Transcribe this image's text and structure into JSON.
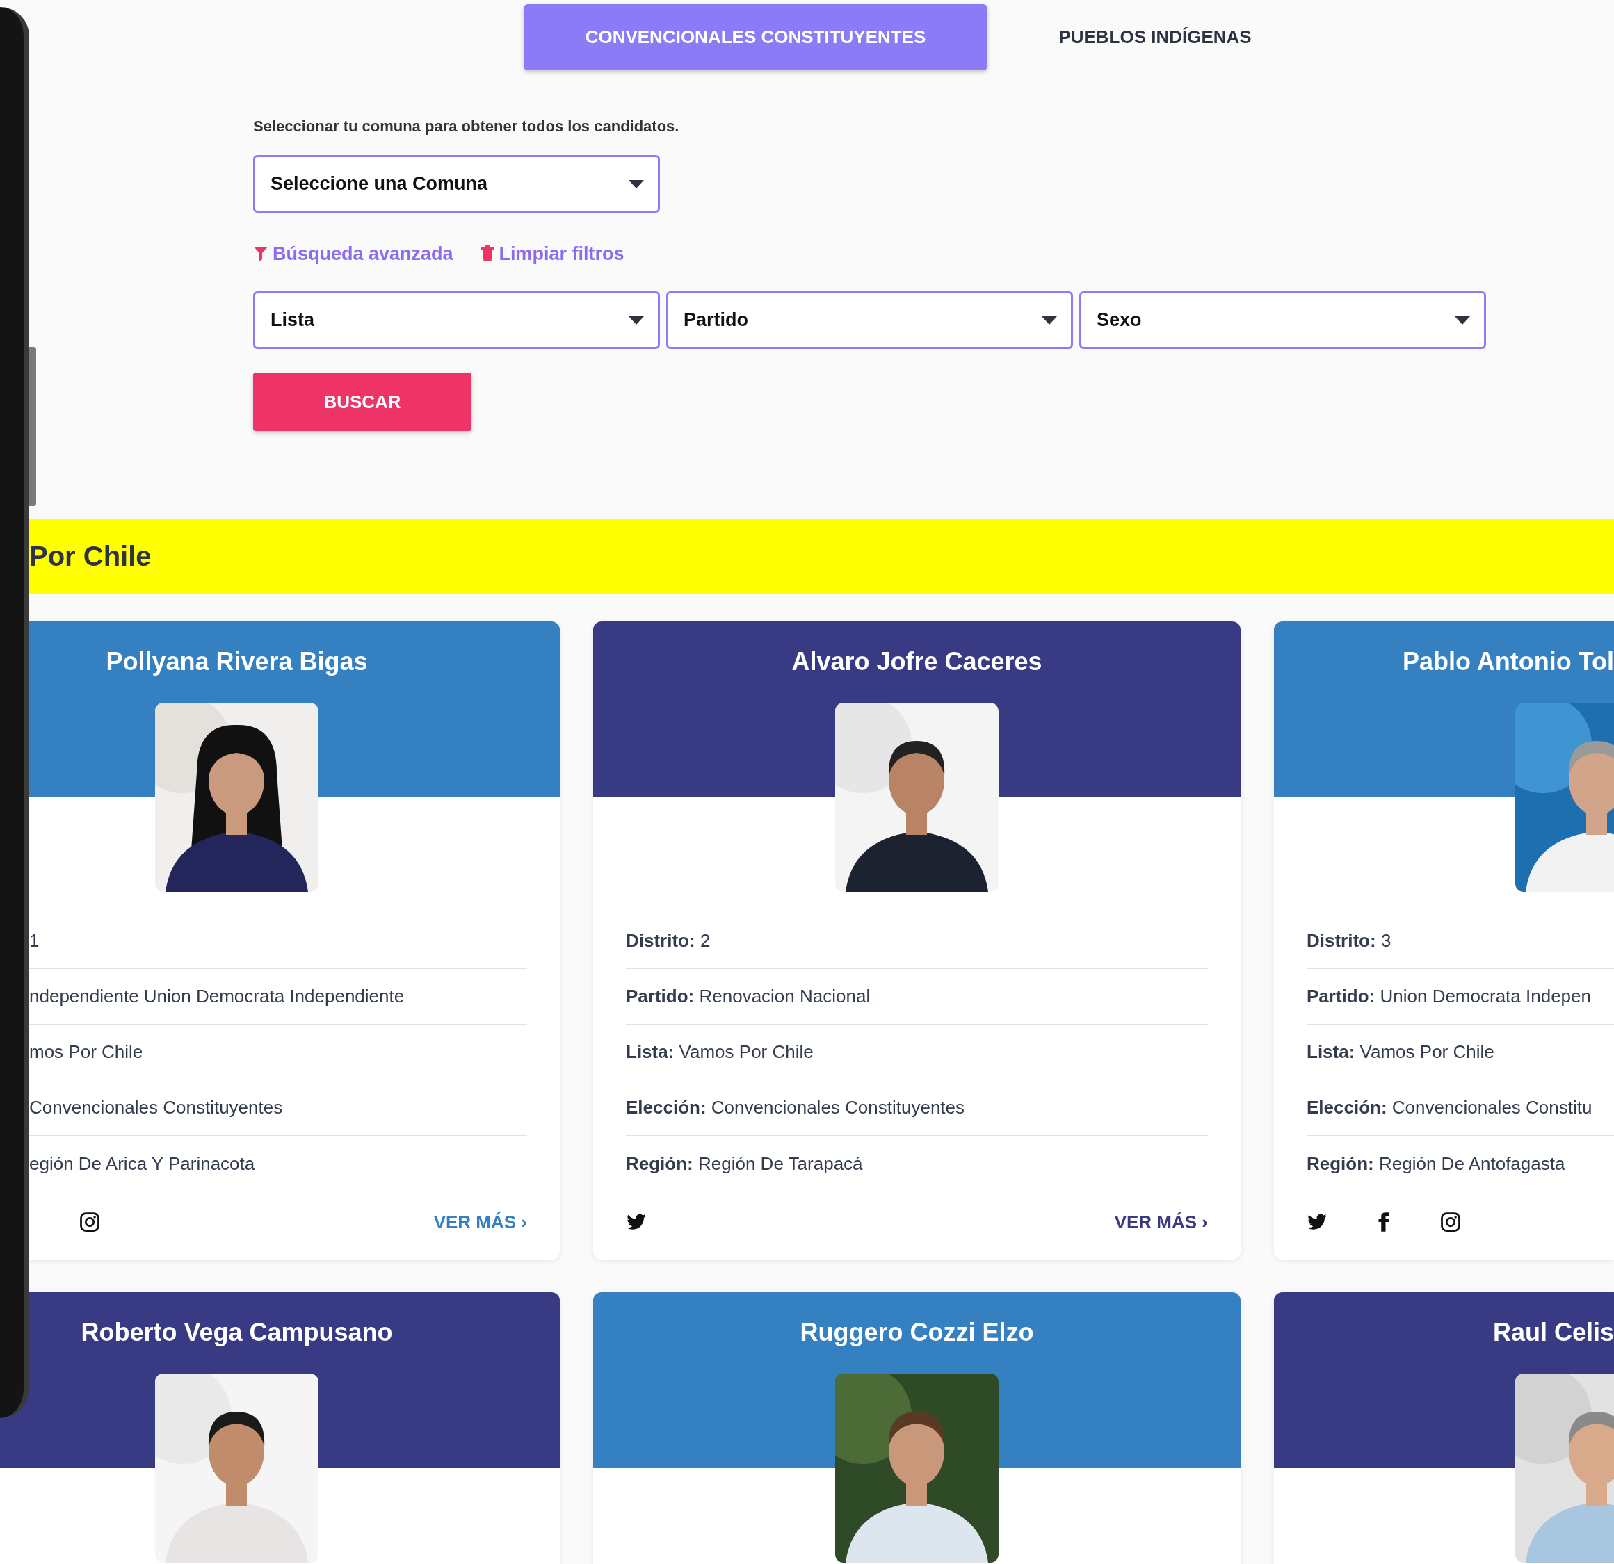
{
  "tabs": [
    {
      "label": "CONVENCIONALES CONSTITUYENTES",
      "selected": true
    },
    {
      "label": "PUEBLOS INDÍGENAS",
      "selected": false
    }
  ],
  "instruction": "Seleccionar tu comuna para obtener todos los candidatos.",
  "comuna_select": {
    "value": "Seleccione una Comuna"
  },
  "links": [
    {
      "kind": "filter",
      "label": "Búsqueda avanzada"
    },
    {
      "kind": "clear",
      "label": "Limpiar filtros"
    }
  ],
  "filters": [
    {
      "value": "Lista"
    },
    {
      "value": "Partido"
    },
    {
      "value": "Sexo"
    }
  ],
  "search_button": "BUSCAR",
  "group": {
    "title": "Por Chile"
  },
  "card_rows": [
    {
      "cards": [
        {
          "name": "Pollyana Rivera Bigas",
          "color": "#3480c0",
          "photo": {
            "kind": "picture"
          },
          "details": [
            {
              "value": "1"
            },
            {
              "value": "ndependiente Union Democrata Independiente"
            },
            {
              "value": "mos Por Chile"
            },
            {
              "value": "Convencionales Constituyentes"
            },
            {
              "value": "egión De Arica Y Parinacota"
            }
          ],
          "socials": [
            {
              "kind": "instagram"
            }
          ],
          "more_link": "VER MÁS ›"
        },
        {
          "name": "Alvaro Jofre Caceres",
          "color": "#383a84",
          "photo": {
            "kind": "picture"
          },
          "details": [
            {
              "label": "Distrito:",
              "value": "2"
            },
            {
              "label": "Partido:",
              "value": "Renovacion Nacional"
            },
            {
              "label": "Lista:",
              "value": "Vamos Por Chile"
            },
            {
              "label": "Elección:",
              "value": "Convencionales Constituyentes"
            },
            {
              "label": "Región:",
              "value": "Región De Tarapacá"
            }
          ],
          "socials": [
            {
              "kind": "twitter"
            }
          ],
          "more_link": "VER MÁS ›"
        },
        {
          "name": "Pablo Antonio Tol",
          "color": "#3480c0",
          "photo": {
            "kind": "picture"
          },
          "details": [
            {
              "label": "Distrito:",
              "value": "3"
            },
            {
              "label": "Partido:",
              "value": "Union Democrata Indepen"
            },
            {
              "label": "Lista:",
              "value": "Vamos Por Chile"
            },
            {
              "label": "Elección:",
              "value": "Convencionales Constitu"
            },
            {
              "label": "Región:",
              "value": "Región De Antofagasta"
            }
          ],
          "socials": [
            {
              "kind": "twitter"
            },
            {
              "kind": "facebook"
            },
            {
              "kind": "instagram"
            }
          ]
        }
      ]
    },
    {
      "cards": [
        {
          "name": "Roberto Vega Campusano",
          "color": "#383a84",
          "photo": {
            "kind": "picture"
          }
        },
        {
          "name": "Ruggero Cozzi Elzo",
          "color": "#3480c0",
          "photo": {
            "kind": "picture"
          }
        },
        {
          "name": "Raul Celis",
          "color": "#383a84",
          "photo": {
            "kind": "picture"
          }
        }
      ]
    }
  ]
}
